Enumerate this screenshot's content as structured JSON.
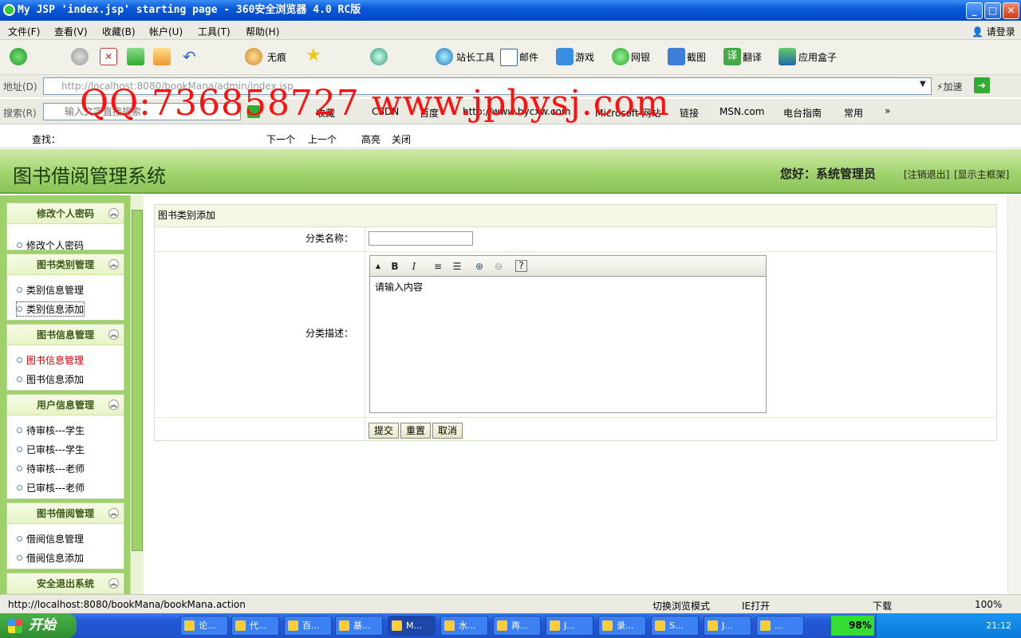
{
  "window": {
    "title": "My JSP 'index.jsp' starting page - 360安全浏览器 4.0 RC版",
    "min": "_",
    "max": "□",
    "close": "✕"
  },
  "menu": [
    "文件(F)",
    "查看(V)",
    "收藏(B)",
    "帐户(U)",
    "工具(T)",
    "帮助(H)"
  ],
  "login": "请登录",
  "toolbar": {
    "notrace": "无痕",
    "webmaster": "站长工具",
    "mail": "邮件",
    "games": "游戏",
    "netbank": "网银",
    "screenshot": "截图",
    "translate": "翻译",
    "appbox": "应用盒子"
  },
  "address": {
    "label": "地址(D)",
    "url": "http://localhost:8080/bookMana/admin/index.jsp",
    "speedup": "加速"
  },
  "searchbar": {
    "label": "搜索(R)",
    "placeholder": "输入文字直接搜索",
    "bookmarks": [
      "收藏",
      "CSDN",
      "百度",
      "http://www.bycxw.com",
      "Microsoft 网站",
      "链接",
      "MSN.com",
      "电台指南",
      "常用"
    ],
    "more": "»"
  },
  "findbar": {
    "find": "查找：",
    "next": "下一个",
    "prev": "上一个",
    "highlight": "高亮",
    "close": "关闭"
  },
  "banner": {
    "title": "图书借阅管理系统",
    "greeting": "您好：系统管理员",
    "logout": "[注销退出]",
    "main_frame": "[显示主框架]"
  },
  "sidebar": [
    {
      "title": "修改个人密码",
      "items": [
        "修改个人密码"
      ]
    },
    {
      "title": "图书类别管理",
      "items": [
        "类别信息管理",
        "类别信息添加"
      ]
    },
    {
      "title": "图书信息管理",
      "items": [
        "图书信息管理",
        "图书信息添加"
      ]
    },
    {
      "title": "用户信息管理",
      "items": [
        "待审核---学生",
        "已审核---学生",
        "待审核---老师",
        "已审核---老师"
      ]
    },
    {
      "title": "图书借阅管理",
      "items": [
        "借阅信息管理",
        "借阅信息添加"
      ]
    },
    {
      "title": "安全退出系统",
      "items": []
    }
  ],
  "form": {
    "caption": "图书类别添加",
    "name_label": "分类名称：",
    "name_value": "",
    "desc_label": "分类描述：",
    "desc_value": "请输入内容",
    "editor_buttons": [
      "B",
      "I",
      "≡",
      "☰",
      "⊕",
      "⊖",
      "?"
    ],
    "submit": "提交",
    "reset": "重置",
    "cancel": "取消"
  },
  "status": {
    "url": "http://localhost:8080/bookMana/bookMana.action",
    "mode": "切换浏览模式",
    "ie": "IE打开",
    "download": "下载",
    "zoom": "100%"
  },
  "taskbar": {
    "start": "开始",
    "tasks": [
      "论...",
      "代...",
      "百...",
      "基...",
      "M...",
      "水...",
      "再...",
      "J...",
      "录...",
      "S...",
      "J...",
      "..."
    ],
    "battery": "98%",
    "clock": "21:12"
  },
  "watermark": "QQ:736858727  www.jpbysj.com"
}
